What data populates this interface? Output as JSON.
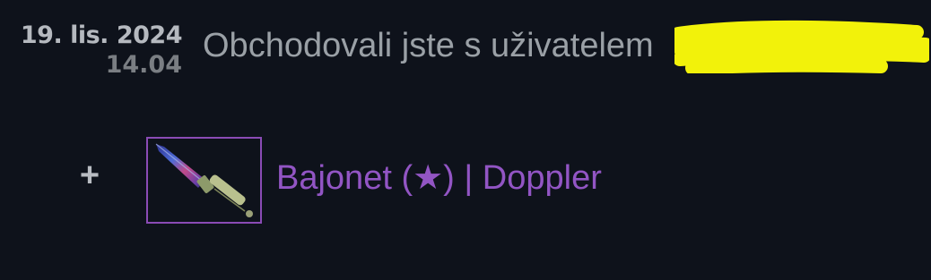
{
  "trade": {
    "date": "19. lis. 2024",
    "time": "14.04",
    "headline": "Obchodovali jste s uživatelem",
    "redaction_color": "#f2f20a"
  },
  "items": [
    {
      "prefix": "+",
      "name": "Bajonet (★) | Doppler",
      "icon": "bayonet-doppler-knife-icon",
      "rarity_color": "#8a4bb5"
    }
  ]
}
